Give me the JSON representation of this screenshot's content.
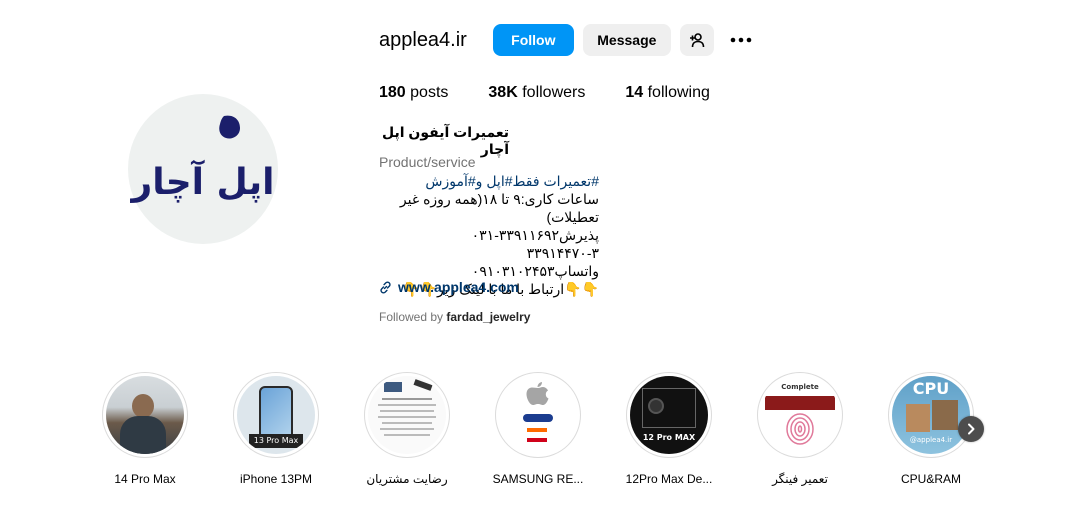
{
  "profile": {
    "username": "applea4.ir",
    "follow_label": "Follow",
    "message_label": "Message",
    "posts_count": "180",
    "posts_label": "posts",
    "followers_count": "38K",
    "followers_label": "followers",
    "following_count": "14",
    "following_label": "following",
    "display_name": "تعمیرات آیفون اپل آچار",
    "category": "Product/service",
    "bio_line1_tags": "#تعمیرات فقط#اپل و#آموزش",
    "bio_line2": "ساعات کاری:۹ تا ۱۸(همه روزه غیر تعطیلات)",
    "bio_line3": "پذیرش۳۳۹۱۱۶۹۲-۰۳۱",
    "bio_line4": "۳۳۹۱۴۴۷۰-۳",
    "bio_line5": "واتساپ۰۹۱۰۳۱۰۲۴۵۳",
    "bio_line6": "👇👇ارتباط با ما با لینک زیر👇👇",
    "link": "www.applea4.com",
    "followed_by_prefix": "Followed by",
    "followed_by_user": "fardad_jewelry",
    "avatar_text": "اپل آچار"
  },
  "highlights": [
    {
      "label": "14 Pro Max"
    },
    {
      "label": "iPhone 13PM",
      "badge": "13 Pro Max"
    },
    {
      "label": "رضایت مشتریان"
    },
    {
      "label": "SAMSUNG RE..."
    },
    {
      "label": "12Pro Max De...",
      "badge": "12 Pro MAX"
    },
    {
      "label": "تعمیر فینگر",
      "badge": "Complete"
    },
    {
      "label": "CPU&RAM",
      "badge": "CPU",
      "watermark": "@applea4.ir"
    }
  ],
  "colors": {
    "accent": "#0095f6",
    "link": "#00376b",
    "muted": "#737373",
    "button_bg": "#efefef"
  }
}
